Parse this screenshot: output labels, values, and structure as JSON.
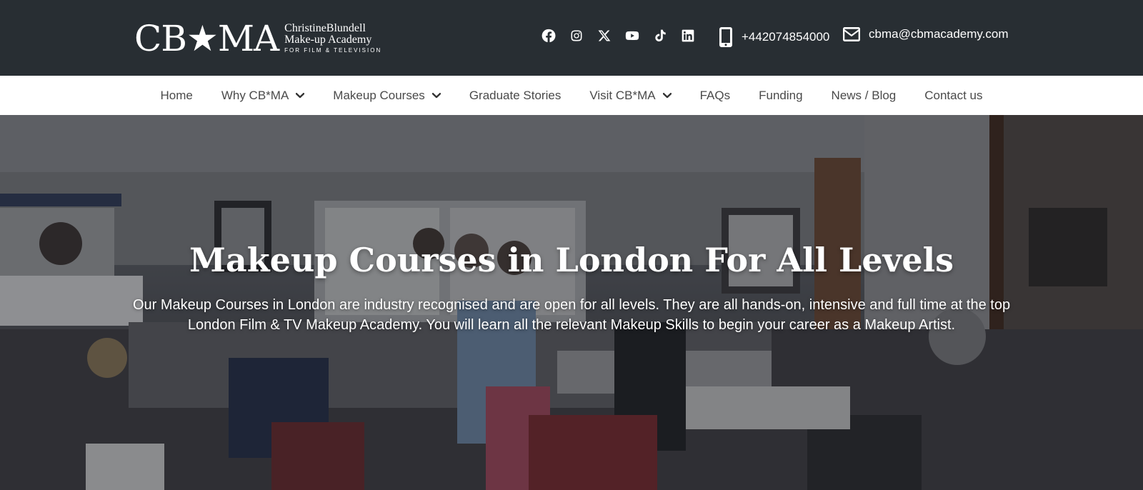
{
  "header": {
    "logo": {
      "mark": "CB★MA",
      "line1": "ChristineBlundell",
      "line2": "Make-up Academy",
      "line3": "FOR FILM & TELEVISION"
    },
    "socials": [
      "facebook-icon",
      "instagram-icon",
      "x-twitter-icon",
      "youtube-icon",
      "tiktok-icon",
      "linkedin-icon"
    ],
    "phone": "+442074854000",
    "email": "cbma@cbmacademy.com"
  },
  "nav": {
    "items": [
      {
        "label": "Home",
        "dropdown": false
      },
      {
        "label": "Why CB*MA",
        "dropdown": true
      },
      {
        "label": "Makeup Courses",
        "dropdown": true
      },
      {
        "label": "Graduate Stories",
        "dropdown": false
      },
      {
        "label": "Visit CB*MA",
        "dropdown": true
      },
      {
        "label": "FAQs",
        "dropdown": false
      },
      {
        "label": "Funding",
        "dropdown": false
      },
      {
        "label": "News / Blog",
        "dropdown": false
      },
      {
        "label": "Contact us",
        "dropdown": false
      }
    ]
  },
  "hero": {
    "title": "Makeup Courses in London For All Levels",
    "subtitle": "Our Makeup Courses in London are industry recognised and are open for all levels. They are all hands-on, intensive and full time at the top London Film & TV Makeup Academy. You will learn all the relevant Makeup Skills to begin your career as a Makeup Artist."
  },
  "colors": {
    "topbar": "#282e33",
    "nav_text": "#4a4a4a",
    "white": "#ffffff"
  }
}
